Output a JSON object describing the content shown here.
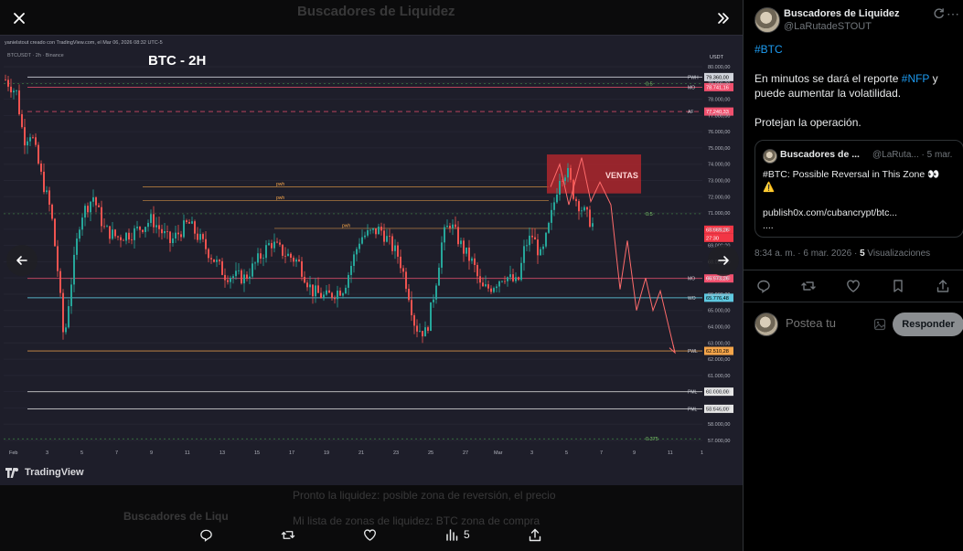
{
  "background_post": {
    "title": "Buscadores de Liquidez",
    "author": "Buscadores de Liqu",
    "text_line1": "Pronto la liquidez: posible zona de reversión, el precio",
    "text_line2": "Mi lista de zonas de liquidez: BTC zona de compra"
  },
  "chart_image": {
    "watermark": "yanielstout creado con TradingView.com, el Mar 06, 2026 08:32 UTC-5",
    "symbol": "BTCUSDT · 2h · Binance",
    "title": "BTC - 2H",
    "currency": "USDT",
    "zone_label": "VENTAS",
    "brand": "TradingView",
    "price_ticks": [
      "80.000,00",
      "79.000,00",
      "78.000,00",
      "77.000,00",
      "76.000,00",
      "75.000,00",
      "74.000,00",
      "73.000,00",
      "72.000,00",
      "71.000,00",
      "70.000,00",
      "69.000,00",
      "68.000,00",
      "67.000,00",
      "66.000,00",
      "65.000,00",
      "64.000,00",
      "63.000,00",
      "62.000,00",
      "61.000,00",
      "60.000,00",
      "59.000,00",
      "58.000,00",
      "57.000,00"
    ],
    "date_ticks": [
      "Feb",
      "3",
      "5",
      "7",
      "9",
      "11",
      "13",
      "15",
      "17",
      "19",
      "21",
      "23",
      "25",
      "27",
      "Mar",
      "3",
      "5",
      "7",
      "9",
      "11",
      "1"
    ],
    "levels": [
      {
        "name": "PWH",
        "value": 79.36,
        "label": "79.360,00",
        "color": "#d1d4dc",
        "text": "#000",
        "style": "solid",
        "left_label": "PWH"
      },
      {
        "name": "MO",
        "value": 78.741,
        "label": "78.741,16",
        "color": "#f0506e",
        "text": "#fff",
        "style": "solid",
        "left_label": "MO"
      },
      {
        "name": "AF",
        "value": 77.24,
        "label": "77.240,33",
        "color": "#f0506e",
        "text": "#fff",
        "style": "dashed",
        "left_label": "AF"
      },
      {
        "name": "last",
        "value": 69.97,
        "label": "69.969,26",
        "color": "#f23645",
        "text": "#fff",
        "style": "none",
        "left_label": ""
      },
      {
        "name": "MO2",
        "value": 66.97,
        "label": "66.973,26",
        "color": "#f0506e",
        "text": "#fff",
        "style": "solid",
        "left_label": "MO"
      },
      {
        "name": "WO",
        "value": 65.78,
        "label": "65.776,48",
        "color": "#5ec8e0",
        "text": "#000",
        "style": "solid",
        "left_label": "WO"
      },
      {
        "name": "PWL",
        "value": 62.51,
        "label": "62.510,28",
        "color": "#f5a54a",
        "text": "#000",
        "style": "solid",
        "left_label": "PWL"
      },
      {
        "name": "PML",
        "value": 60.0,
        "label": "60.000,00",
        "color": "#e6e6e6",
        "text": "#000",
        "style": "solid",
        "left_label": "PML"
      },
      {
        "name": "PML2",
        "value": 58.946,
        "label": "58.946,00",
        "color": "#e6e6e6",
        "text": "#000",
        "style": "solid",
        "left_label": "PML"
      }
    ],
    "fib_labels": [
      {
        "text": "0.5",
        "value": 78.95
      },
      {
        "text": "0.5",
        "value": 70.95
      },
      {
        "text": "0.375",
        "value": 57.1
      }
    ],
    "pwh_lines": [
      {
        "text": "pwh",
        "value": 72.6
      },
      {
        "text": "pwh",
        "value": 71.75
      },
      {
        "text": "pwh",
        "value": 70.05
      }
    ],
    "countdown_label": "27:30"
  },
  "media_actions": {
    "views": "5"
  },
  "tweet": {
    "author_name": "Buscadores de Liquidez",
    "author_handle": "@LaRutadeSTOUT",
    "hashtag": "#BTC",
    "line2_a": "En minutos se dará el reporte ",
    "line2_tag": "#NFP",
    "line2_b": " y puede aumentar la volatilidad.",
    "line3": "Protejan la operación.",
    "quote": {
      "name": "Buscadores de ...",
      "handle": "@LaRuta... · 5 mar.",
      "line1": "#BTC: Possible Reversal in This Zone 👀",
      "line2": "⚠️",
      "line3": "publish0x.com/cubancrypt/btc...",
      "line4": "...."
    },
    "time": "8:34 a. m. · 6 mar. 2026 · ",
    "views_count": "5",
    "views_label": " Visualizaciones",
    "reply_placeholder": "Postea tu",
    "reply_button": "Responder"
  },
  "colors": {
    "accent": "#1d9bf0",
    "chart_bg": "#1e1e2a",
    "candle_up": "#26a69a",
    "candle_down": "#ef5350",
    "ventas_zone": "#c0282d"
  }
}
